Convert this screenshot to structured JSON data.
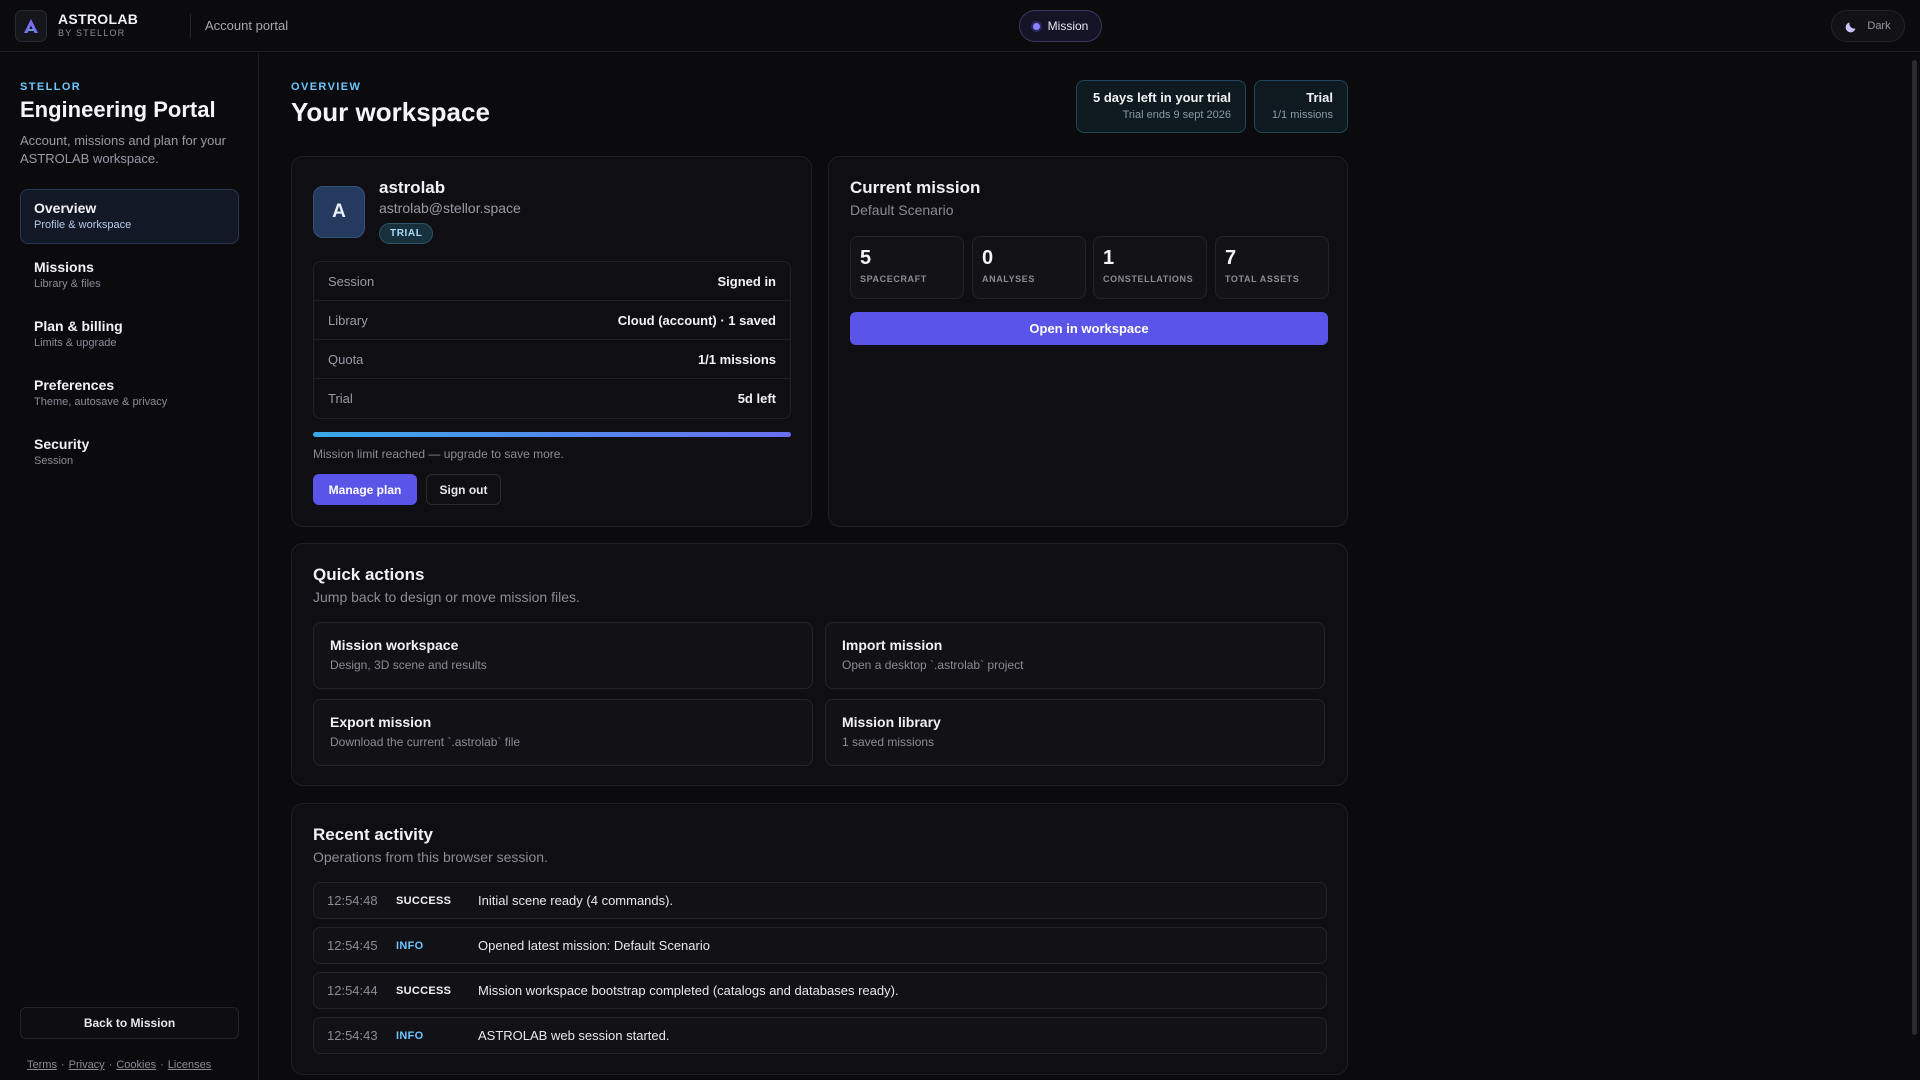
{
  "topbar": {
    "brand_name": "ASTROLAB",
    "brand_sub": "BY STELLOR",
    "portal_label": "Account portal",
    "mission_pill": "Mission",
    "theme_toggle": "Dark"
  },
  "sidebar": {
    "eyebrow": "STELLOR",
    "title": "Engineering Portal",
    "description": "Account, missions and plan for your ASTROLAB workspace.",
    "items": [
      {
        "label": "Overview",
        "sub": "Profile & workspace"
      },
      {
        "label": "Missions",
        "sub": "Library & files"
      },
      {
        "label": "Plan & billing",
        "sub": "Limits & upgrade"
      },
      {
        "label": "Preferences",
        "sub": "Theme, autosave & privacy"
      },
      {
        "label": "Security",
        "sub": "Session"
      }
    ],
    "back_button": "Back to Mission",
    "footer_links": [
      "Terms",
      "Privacy",
      "Cookies",
      "Licenses"
    ]
  },
  "header": {
    "eyebrow": "OVERVIEW",
    "title": "Your workspace",
    "trial_box": {
      "main": "5 days left in your trial",
      "sub": "Trial ends 9 sept 2026"
    },
    "plan_box": {
      "main": "Trial",
      "sub": "1/1 missions"
    }
  },
  "account": {
    "avatar_letter": "A",
    "name": "astrolab",
    "email": "astrolab@stellor.space",
    "badge": "TRIAL",
    "rows": [
      {
        "key": "Session",
        "value": "Signed in"
      },
      {
        "key": "Library",
        "value": "Cloud (account) · 1 saved"
      },
      {
        "key": "Quota",
        "value": "1/1 missions"
      },
      {
        "key": "Trial",
        "value": "5d left"
      }
    ],
    "quota_progress": 1.0,
    "limit_note": "Mission limit reached — upgrade to save more.",
    "manage_button": "Manage plan",
    "signout_button": "Sign out"
  },
  "current_mission": {
    "title": "Current mission",
    "subtitle": "Default Scenario",
    "stats": [
      {
        "value": "5",
        "label": "SPACECRAFT"
      },
      {
        "value": "0",
        "label": "ANALYSES"
      },
      {
        "value": "1",
        "label": "CONSTELLATIONS"
      },
      {
        "value": "7",
        "label": "TOTAL ASSETS"
      }
    ],
    "open_button": "Open in workspace"
  },
  "quick_actions": {
    "title": "Quick actions",
    "subtitle": "Jump back to design or move mission files.",
    "items": [
      {
        "title": "Mission workspace",
        "sub": "Design, 3D scene and results"
      },
      {
        "title": "Import mission",
        "sub": "Open a desktop `.astrolab` project"
      },
      {
        "title": "Export mission",
        "sub": "Download the current `.astrolab` file"
      },
      {
        "title": "Mission library",
        "sub": "1 saved missions"
      }
    ]
  },
  "recent_activity": {
    "title": "Recent activity",
    "subtitle": "Operations from this browser session.",
    "rows": [
      {
        "time": "12:54:48",
        "level": "SUCCESS",
        "message": "Initial scene ready (4 commands)."
      },
      {
        "time": "12:54:45",
        "level": "INFO",
        "message": "Opened latest mission: Default Scenario"
      },
      {
        "time": "12:54:44",
        "level": "SUCCESS",
        "message": "Mission workspace bootstrap completed (catalogs and databases ready)."
      },
      {
        "time": "12:54:43",
        "level": "INFO",
        "message": "ASTROLAB web session started."
      }
    ]
  },
  "colors": {
    "accent": "#5b54e8",
    "info": "#6cc6ff",
    "background": "#0b0b0e"
  }
}
